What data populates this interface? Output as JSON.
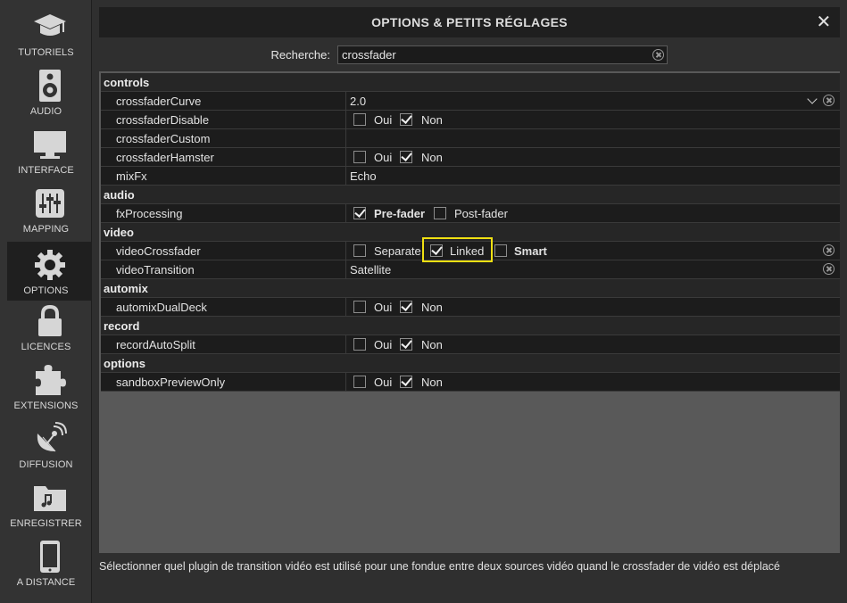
{
  "sidebar": {
    "items": [
      {
        "label": "TUTORIELS",
        "icon": "graduation-cap-icon"
      },
      {
        "label": "AUDIO",
        "icon": "speaker-icon"
      },
      {
        "label": "INTERFACE",
        "icon": "monitor-icon"
      },
      {
        "label": "MAPPING",
        "icon": "sliders-icon"
      },
      {
        "label": "OPTIONS",
        "icon": "gear-icon",
        "active": true
      },
      {
        "label": "LICENCES",
        "icon": "lock-icon"
      },
      {
        "label": "EXTENSIONS",
        "icon": "puzzle-icon"
      },
      {
        "label": "DIFFUSION",
        "icon": "broadcast-dish-icon"
      },
      {
        "label": "ENREGISTRER",
        "icon": "music-folder-icon"
      },
      {
        "label": "A DISTANCE",
        "icon": "smartphone-icon"
      }
    ]
  },
  "dialog": {
    "title": "OPTIONS & PETITS RÉGLAGES",
    "close_label": "✕"
  },
  "search": {
    "label": "Recherche:",
    "value": "crossfader"
  },
  "categories": {
    "controls": "controls",
    "audio": "audio",
    "video": "video",
    "automix": "automix",
    "record": "record",
    "options": "options"
  },
  "options": {
    "crossfaderCurve": {
      "name": "crossfaderCurve",
      "value": "2.0"
    },
    "crossfaderDisable": {
      "name": "crossfaderDisable",
      "yes": "Oui",
      "no": "Non",
      "selected": "Non"
    },
    "crossfaderCustom": {
      "name": "crossfaderCustom",
      "value": ""
    },
    "crossfaderHamster": {
      "name": "crossfaderHamster",
      "yes": "Oui",
      "no": "Non",
      "selected": "Non"
    },
    "mixFx": {
      "name": "mixFx",
      "value": "Echo"
    },
    "fxProcessing": {
      "name": "fxProcessing",
      "opt1": "Pre-fader",
      "opt2": "Post-fader",
      "selected": "Pre-fader"
    },
    "videoCrossfader": {
      "name": "videoCrossfader",
      "opt1": "Separate",
      "opt2": "Linked",
      "opt3": "Smart",
      "selected": "Linked"
    },
    "videoTransition": {
      "name": "videoTransition",
      "value": "Satellite"
    },
    "automixDualDeck": {
      "name": "automixDualDeck",
      "yes": "Oui",
      "no": "Non",
      "selected": "Non"
    },
    "recordAutoSplit": {
      "name": "recordAutoSplit",
      "yes": "Oui",
      "no": "Non",
      "selected": "Non"
    },
    "sandboxPreviewOnly": {
      "name": "sandboxPreviewOnly",
      "yes": "Oui",
      "no": "Non",
      "selected": "Non"
    }
  },
  "description": "Sélectionner quel plugin de transition vidéo est utilisé pour une fondue entre deux sources vidéo quand le crossfader de vidéo est déplacé",
  "colors": {
    "highlight": "#f0e012",
    "background": "#2f2f2f",
    "panel": "#1c1c1c"
  }
}
